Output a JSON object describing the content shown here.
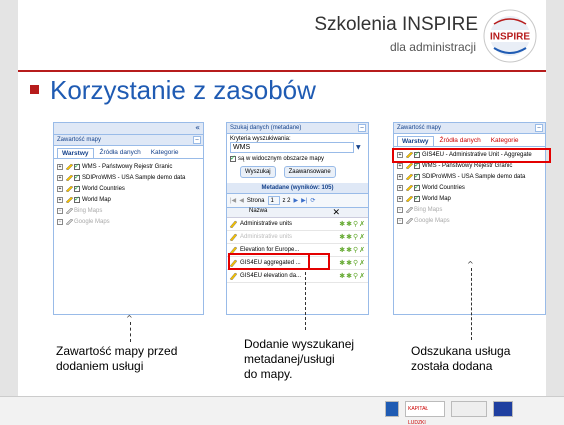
{
  "header": {
    "brand_title": "Szkolenia INSPIRE",
    "brand_subtitle": "dla administracji",
    "logo_text": "INSPIRE"
  },
  "slide_title": "Korzystanie z zasobów",
  "left_panel": {
    "header": "Zawartość mapy",
    "tabs": [
      "Warstwy",
      "Źródła danych",
      "Kategorie"
    ],
    "layers": [
      {
        "label": "WMS - Państwowy Rejestr Granic",
        "checked": true,
        "gray": false
      },
      {
        "label": "SDIProWMS - USA Sample demo data",
        "checked": true,
        "gray": false
      },
      {
        "label": "World Countries",
        "checked": true,
        "gray": false
      },
      {
        "label": "World Map",
        "checked": true,
        "gray": false
      },
      {
        "label": "Bing Maps",
        "checked": false,
        "gray": true
      },
      {
        "label": "Google Maps",
        "checked": false,
        "gray": true
      }
    ],
    "collapse_glyph": "«"
  },
  "middle_panel": {
    "header": "Szukaj danych (metadane)",
    "criteria_label": "Kryteria wyszukiwania:",
    "criteria_value": "WMS",
    "visible_area_label": "są w widocznym obszarze mapy",
    "search_button": "Wyszukaj",
    "advanced_button": "Zaawansowane",
    "results_header": "Metadane (wyników: 105)",
    "pager_label": "Strona",
    "pager_page": "1",
    "pager_of": "z 2",
    "column_name": "Nazwa",
    "results": [
      "Administrative units",
      "Administrative units",
      "Elevation for Europe...",
      "GIS4EU aggregated ...",
      "GIS4EU elevation da..."
    ]
  },
  "right_panel": {
    "header": "Zawartość mapy",
    "tabs": [
      "Warstwy",
      "Źródła danych",
      "Kategorie"
    ],
    "layers": [
      {
        "label": "GIS4EU - Administrative Unit - Aggregate",
        "checked": true,
        "gray": false
      },
      {
        "label": "WMS - Państwowy Rejestr Granic",
        "checked": true,
        "gray": false
      },
      {
        "label": "SDIProWMS - USA Sample demo data",
        "checked": true,
        "gray": false
      },
      {
        "label": "World Countries",
        "checked": true,
        "gray": false
      },
      {
        "label": "World Map",
        "checked": true,
        "gray": false
      },
      {
        "label": "Bing Maps",
        "checked": false,
        "gray": true
      },
      {
        "label": "Google Maps",
        "checked": false,
        "gray": true
      }
    ]
  },
  "captions": {
    "left": [
      "Zawartość mapy przed",
      "dodaniem usługi"
    ],
    "middle": [
      "Dodanie wyszukanej",
      "metadanej/usługi",
      "do mapy."
    ],
    "right": [
      "Odszukana usługa",
      "została dodana"
    ]
  },
  "footer": {
    "logo1": "KAPITAŁ LUDZKI"
  },
  "colors": {
    "accent": "#b71c1c",
    "title": "#1f5bb3",
    "highlight": "#e30000",
    "panel_border": "#99bbe8"
  }
}
